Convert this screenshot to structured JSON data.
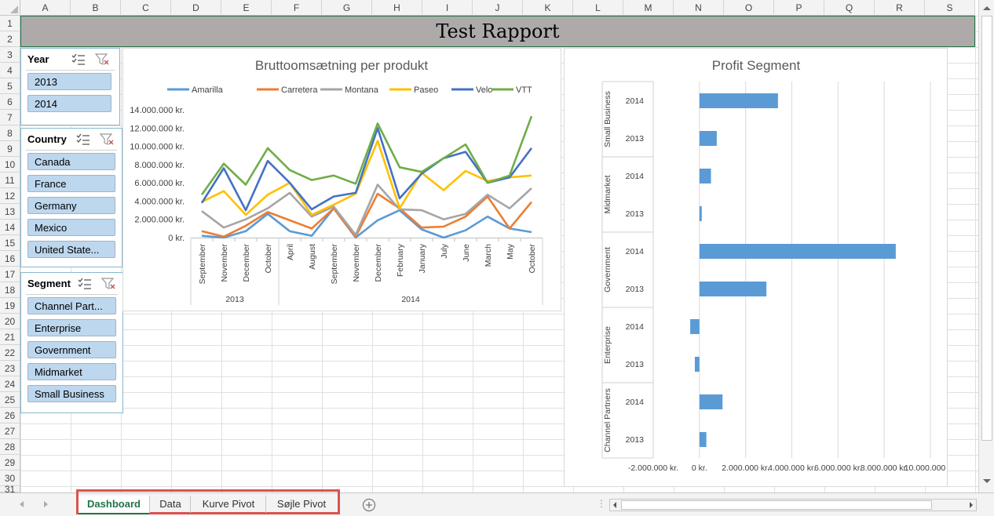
{
  "sheet": {
    "columns": [
      "A",
      "B",
      "C",
      "D",
      "E",
      "F",
      "G",
      "H",
      "I",
      "J",
      "K",
      "L",
      "M",
      "N",
      "O",
      "P",
      "Q",
      "R",
      "S"
    ],
    "rows": [
      "1",
      "2",
      "3",
      "4",
      "5",
      "6",
      "7",
      "8",
      "9",
      "10",
      "11",
      "12",
      "13",
      "14",
      "15",
      "16",
      "17",
      "18",
      "19",
      "20",
      "21",
      "22",
      "23",
      "24",
      "25",
      "26",
      "27",
      "28",
      "29",
      "30",
      "31"
    ]
  },
  "report_title": "Test Rapport",
  "slicers": {
    "year": {
      "title": "Year",
      "items": [
        "2013",
        "2014"
      ]
    },
    "country": {
      "title": "Country",
      "items": [
        "Canada",
        "France",
        "Germany",
        "Mexico",
        "United State..."
      ]
    },
    "segment": {
      "title": "Segment",
      "items": [
        "Channel Part...",
        "Enterprise",
        "Government",
        "Midmarket",
        "Small Business"
      ]
    }
  },
  "tabs": [
    "Dashboard",
    "Data",
    "Kurve Pivot",
    "Søjle Pivot"
  ],
  "active_tab": "Dashboard",
  "icons": {
    "multi_select": "multi-select-icon",
    "clear_filter": "clear-filter-icon",
    "new_sheet": "plus-circle-icon"
  },
  "chart_data": [
    {
      "type": "line",
      "title": "Bruttoomsætning per produkt",
      "x": [
        "September",
        "November",
        "December",
        "October",
        "April",
        "August",
        "September",
        "November",
        "December",
        "February",
        "January",
        "July",
        "June",
        "March",
        "May",
        "October"
      ],
      "x_groups": [
        {
          "label": "2013",
          "count": 4
        },
        {
          "label": "2014",
          "count": 12
        }
      ],
      "y_ticks": [
        "0 kr.",
        "2.000.000 kr.",
        "4.000.000 kr.",
        "6.000.000 kr.",
        "8.000.000 kr.",
        "10.000.000 kr.",
        "12.000.000 kr.",
        "14.000.000 kr."
      ],
      "ylim": [
        0,
        14000000
      ],
      "legend_position": "top",
      "series": [
        {
          "name": "Amarilla",
          "color": "#5b9bd5",
          "values": [
            200000,
            0,
            700000,
            2600000,
            700000,
            200000,
            3200000,
            0,
            1900000,
            3000000,
            900000,
            0,
            800000,
            2300000,
            1000000,
            600000
          ]
        },
        {
          "name": "Carretera",
          "color": "#ed7d31",
          "values": [
            700000,
            100000,
            1300000,
            2800000,
            1900000,
            1000000,
            3200000,
            100000,
            4800000,
            3200000,
            1100000,
            1200000,
            2300000,
            4500000,
            1000000,
            3900000
          ]
        },
        {
          "name": "Montana",
          "color": "#a5a5a5",
          "values": [
            2900000,
            1100000,
            2000000,
            3200000,
            4900000,
            2300000,
            3400000,
            300000,
            5800000,
            3100000,
            3000000,
            2000000,
            2600000,
            4700000,
            3200000,
            5400000
          ]
        },
        {
          "name": "Paseo",
          "color": "#ffc000",
          "values": [
            3900000,
            5100000,
            2500000,
            4700000,
            6000000,
            2500000,
            3600000,
            4800000,
            10600000,
            3200000,
            7100000,
            5200000,
            7300000,
            6200000,
            6600000,
            6800000
          ]
        },
        {
          "name": "Velo",
          "color": "#4472c4",
          "values": [
            3800000,
            7600000,
            3000000,
            8400000,
            6000000,
            3100000,
            4500000,
            4900000,
            12000000,
            4300000,
            7000000,
            8700000,
            9400000,
            6000000,
            6600000,
            9800000
          ]
        },
        {
          "name": "VTT",
          "color": "#70ad47",
          "values": [
            4700000,
            8100000,
            5800000,
            9800000,
            7400000,
            6300000,
            6800000,
            5900000,
            12500000,
            7700000,
            7200000,
            8700000,
            10200000,
            6000000,
            6800000,
            13300000
          ]
        }
      ]
    },
    {
      "type": "bar",
      "orientation": "horizontal",
      "title": "Profit Segment",
      "groups": [
        {
          "label": "Small Business",
          "bars": [
            {
              "year": "2014",
              "value": 3400000
            },
            {
              "year": "2013",
              "value": 750000
            }
          ]
        },
        {
          "label": "Midmarket",
          "bars": [
            {
              "year": "2014",
              "value": 500000
            },
            {
              "year": "2013",
              "value": 100000
            }
          ]
        },
        {
          "label": "Government",
          "bars": [
            {
              "year": "2014",
              "value": 8500000
            },
            {
              "year": "2013",
              "value": 2900000
            }
          ]
        },
        {
          "label": "Enterprise",
          "bars": [
            {
              "year": "2014",
              "value": -400000
            },
            {
              "year": "2013",
              "value": -200000
            }
          ]
        },
        {
          "label": "Channel Partners",
          "bars": [
            {
              "year": "2014",
              "value": 1000000
            },
            {
              "year": "2013",
              "value": 300000
            }
          ]
        }
      ],
      "x_ticks": [
        "-2.000.000 kr.",
        "0 kr.",
        "2.000.000 kr.",
        "4.000.000 kr.",
        "6.000.000 kr.",
        "8.000.000 kr.",
        "10.000.000 kr."
      ],
      "xlim": [
        -2000000,
        10000000
      ],
      "color": "#5b9bd5"
    }
  ]
}
